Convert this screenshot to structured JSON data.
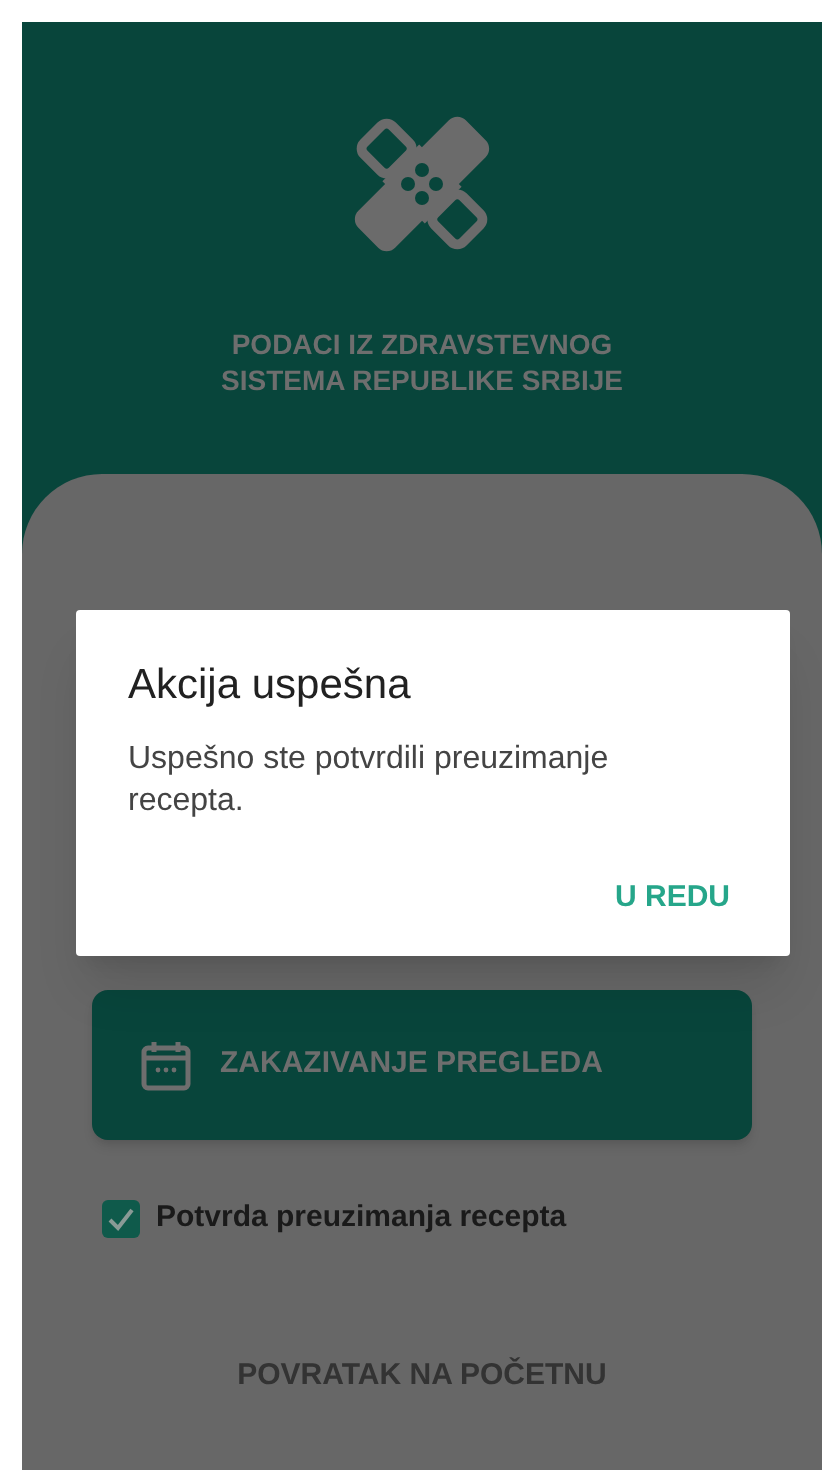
{
  "header": {
    "title_lines": [
      "PODACI IZ ZDRAVSTEVNOG",
      "SISTEMA REPUBLIKE SRBIJE"
    ]
  },
  "menu": {
    "appointment_button": "ZAKAZIVANJE PREGLEDA",
    "checkbox": {
      "label": "Potvrda preuzimanja recepta",
      "checked": true
    },
    "back_link": "POVRATAK NA POČETNU"
  },
  "dialog": {
    "title": "Akcija uspešna",
    "message": "Uspešno ste potvrdili preuzimanje recepta.",
    "action": "U REDU"
  }
}
